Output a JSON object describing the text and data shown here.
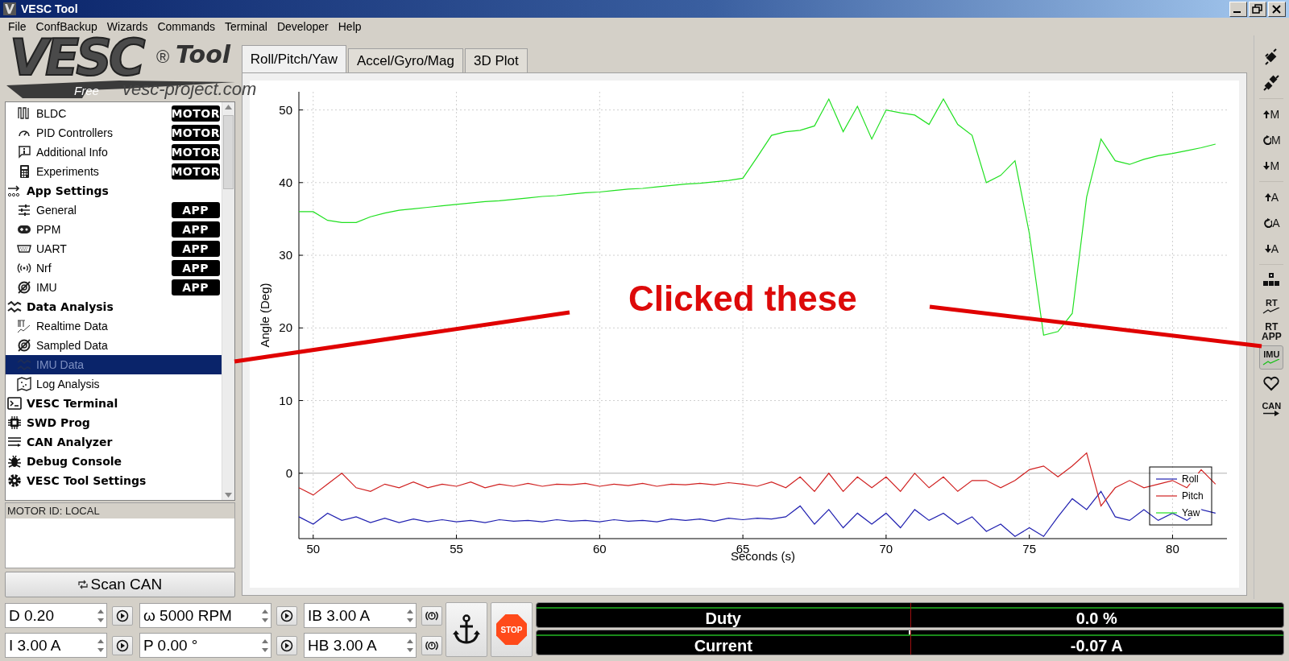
{
  "window": {
    "title": "VESC Tool"
  },
  "menu": [
    "File",
    "ConfBackup",
    "Wizards",
    "Commands",
    "Terminal",
    "Developer",
    "Help"
  ],
  "logo": {
    "mark": "VESC",
    "registered": "®",
    "product": "Tool",
    "edition": "Free",
    "url": "vesc-project.com"
  },
  "sidebar": {
    "items": [
      {
        "children": [
          {
            "label": "BLDC",
            "badge": "MOTOR",
            "selected": false
          },
          {
            "label": "PID Controllers",
            "badge": "MOTOR",
            "selected": false
          },
          {
            "label": "Additional Info",
            "badge": "MOTOR",
            "selected": false
          },
          {
            "label": "Experiments",
            "badge": "MOTOR",
            "selected": false
          }
        ]
      },
      {
        "label": "App Settings",
        "selected": false,
        "children": [
          {
            "label": "General",
            "badge": "APP",
            "selected": false
          },
          {
            "label": "PPM",
            "badge": "APP",
            "selected": false
          },
          {
            "label": "UART",
            "badge": "APP",
            "selected": false
          },
          {
            "label": "Nrf",
            "badge": "APP",
            "selected": false
          },
          {
            "label": "IMU",
            "badge": "APP",
            "selected": false
          }
        ]
      },
      {
        "label": "Data Analysis",
        "selected": false,
        "children": [
          {
            "label": "Realtime Data",
            "selected": false
          },
          {
            "label": "Sampled Data",
            "selected": false
          },
          {
            "label": "IMU Data",
            "selected": true
          },
          {
            "label": "Log Analysis",
            "selected": false
          }
        ]
      },
      {
        "label": "VESC Terminal",
        "selected": false
      },
      {
        "label": "SWD Prog",
        "selected": false
      },
      {
        "label": "CAN Analyzer",
        "selected": false
      },
      {
        "label": "Debug Console",
        "selected": false
      },
      {
        "label": "VESC Tool Settings",
        "selected": false
      }
    ]
  },
  "motor_id": {
    "header": "MOTOR ID: LOCAL"
  },
  "scan_button": "Scan CAN",
  "tabs": [
    {
      "label": "Roll/Pitch/Yaw",
      "selected": true
    },
    {
      "label": "Accel/Gyro/Mag",
      "selected": false
    },
    {
      "label": "3D Plot",
      "selected": false
    }
  ],
  "chart_data": {
    "type": "line",
    "grid": true,
    "legend": true,
    "xlabel": "Seconds (s)",
    "ylabel": "Angle (Deg)",
    "xlim": [
      49.5,
      81.9
    ],
    "ylim": [
      -9,
      52.5
    ],
    "xticks": [
      50,
      55,
      60,
      65,
      70,
      75,
      80
    ],
    "yticks": [
      0,
      10,
      20,
      30,
      40,
      50
    ],
    "x": [
      49.5,
      50,
      50.5,
      51,
      51.5,
      52,
      52.5,
      53,
      53.5,
      54,
      54.5,
      55,
      55.5,
      56,
      56.5,
      57,
      57.5,
      58,
      58.5,
      59,
      59.5,
      60,
      60.5,
      61,
      61.5,
      62,
      62.5,
      63,
      63.5,
      64,
      64.5,
      65,
      65.5,
      66,
      66.5,
      67,
      67.5,
      68,
      68.5,
      69,
      69.5,
      70,
      70.5,
      71,
      71.5,
      72,
      72.5,
      73,
      73.5,
      74,
      74.5,
      75,
      75.5,
      76,
      76.5,
      77,
      77.5,
      78,
      78.5,
      79,
      79.5,
      80,
      80.5,
      81,
      81.5
    ],
    "series": [
      {
        "name": "Roll",
        "color": "#2020b0",
        "values": [
          -6,
          -7,
          -5.5,
          -6.5,
          -6,
          -6.8,
          -6.2,
          -6.8,
          -6.3,
          -6.7,
          -6.4,
          -6.7,
          -6.5,
          -6.8,
          -6.4,
          -6.6,
          -6.5,
          -6.7,
          -6.4,
          -6.6,
          -6.5,
          -6.7,
          -6.4,
          -6.6,
          -6.5,
          -6.7,
          -6.3,
          -6.5,
          -6.3,
          -6.6,
          -6.2,
          -6.4,
          -6.2,
          -6.3,
          -6,
          -4.5,
          -7,
          -5,
          -7.5,
          -5.5,
          -7,
          -5.5,
          -7.5,
          -5,
          -6.5,
          -5.5,
          -7,
          -6,
          -8,
          -7,
          -8.7,
          -7.5,
          -8.7,
          -6,
          -3.5,
          -5,
          -2.5,
          -6,
          -6.5,
          -5,
          -6.5,
          -5.5,
          -6.5,
          -5,
          -5.5
        ]
      },
      {
        "name": "Pitch",
        "color": "#d02020",
        "values": [
          -2,
          -3,
          -1.5,
          0,
          -2,
          -2.5,
          -1.5,
          -2,
          -1.2,
          -2,
          -1.5,
          -1.8,
          -1.2,
          -2,
          -1.5,
          -1.8,
          -1.4,
          -1.8,
          -1.5,
          -1.6,
          -1.4,
          -1.8,
          -1.5,
          -1.7,
          -1.4,
          -1.8,
          -1.5,
          -1.6,
          -1.4,
          -1.6,
          -1.3,
          -1.5,
          -1.8,
          -1.2,
          -2,
          -0.5,
          -2.5,
          0,
          -2.5,
          -0.5,
          -2,
          -0.5,
          -2.5,
          0,
          -2,
          -0.5,
          -2.5,
          -1,
          -1,
          -2,
          -1,
          0.5,
          1,
          -0.5,
          1,
          2.8,
          -4.5,
          -2,
          -1,
          -2,
          -1.5,
          -1,
          -2,
          0.5,
          -1.5
        ]
      },
      {
        "name": "Yaw",
        "color": "#20e020",
        "values": [
          36,
          36,
          34.8,
          34.5,
          34.5,
          35.3,
          35.8,
          36.2,
          36.4,
          36.6,
          36.8,
          37,
          37.2,
          37.4,
          37.5,
          37.7,
          37.9,
          38.1,
          38.2,
          38.4,
          38.6,
          38.7,
          38.9,
          39.1,
          39.2,
          39.4,
          39.6,
          39.8,
          39.9,
          40.1,
          40.3,
          40.6,
          43.5,
          46.5,
          47,
          47.2,
          47.8,
          51.5,
          47,
          50.5,
          46,
          50,
          49.6,
          49.3,
          48,
          51.5,
          48,
          46.5,
          40,
          41,
          43,
          33,
          19,
          19.5,
          22,
          38,
          46,
          43,
          42.5,
          43.2,
          43.7,
          44,
          44.4,
          44.8,
          45.3
        ]
      }
    ]
  },
  "annotation": {
    "text": "Clicked these"
  },
  "toolbar": {
    "groups": [
      [
        {
          "kind": "connect",
          "selected": false
        },
        {
          "kind": "disconnect",
          "selected": false
        }
      ],
      [
        {
          "kind": "write",
          "lines": [
            "M"
          ],
          "selected": false
        },
        {
          "kind": "reload",
          "lines": [
            "M"
          ],
          "selected": false
        },
        {
          "kind": "read",
          "lines": [
            "M"
          ],
          "selected": false
        }
      ],
      [
        {
          "kind": "write",
          "lines": [
            "A"
          ],
          "selected": false
        },
        {
          "kind": "reload",
          "lines": [
            "A"
          ],
          "selected": false
        },
        {
          "kind": "read",
          "lines": [
            "A"
          ],
          "selected": false
        }
      ],
      [
        {
          "kind": "tree",
          "selected": false
        },
        {
          "kind": "chart",
          "lines": [
            "RT"
          ],
          "selected": false
        },
        {
          "kind": "text",
          "lines": [
            "RT",
            "APP"
          ],
          "selected": false
        },
        {
          "kind": "chart",
          "lines": [
            "IMU"
          ],
          "selected": true
        },
        {
          "kind": "heart",
          "selected": false
        },
        {
          "kind": "arrow",
          "lines": [
            "CAN"
          ],
          "selected": false
        }
      ]
    ]
  },
  "controls": [
    [
      {
        "value": "D 0.20",
        "kind": "play"
      },
      {
        "value": "ω 5000 RPM",
        "kind": "play"
      },
      {
        "value": "IB 3.00 A",
        "kind": "brake"
      }
    ],
    [
      {
        "value": "I 3.00 A",
        "kind": "play"
      },
      {
        "value": "P 0.00 °",
        "kind": "play"
      },
      {
        "value": "HB 3.00 A",
        "kind": "brake"
      }
    ]
  ],
  "stop_button": "STOP",
  "gauges": [
    {
      "label": "Duty",
      "value": "0.0 %"
    },
    {
      "label": "Current",
      "value": "-0.07 A"
    }
  ]
}
